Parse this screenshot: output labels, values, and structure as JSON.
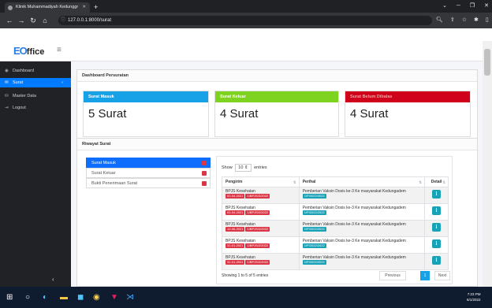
{
  "browser": {
    "tab_title": "Klinik Muhammadiyah Kedunggr",
    "url": "127.0.0.1:8000/surat"
  },
  "app": {
    "logo_text": "ffice",
    "sidebar": {
      "items": [
        {
          "label": "Dashboard",
          "icon": "palette-icon"
        },
        {
          "label": "Surat",
          "icon": "envelope-icon"
        },
        {
          "label": "Master Data",
          "icon": "database-icon"
        },
        {
          "label": "Logout",
          "icon": "logout-icon"
        }
      ]
    },
    "page_title": "Dashboard Persuratan",
    "cards": [
      {
        "label": "Surat Masuk",
        "value": "5 Surat",
        "color": "#17a2e8"
      },
      {
        "label": "Surat Keluar",
        "value": "4 Surat",
        "color": "#7ed321"
      },
      {
        "label": "Surat Belum Dibalas",
        "value": "4 Surat",
        "color": "#d0021b"
      }
    ],
    "riwayat": {
      "title": "Riwayat Surat",
      "list": [
        {
          "label": "Surat Masuk",
          "active": true
        },
        {
          "label": "Surat Keluar",
          "active": false
        },
        {
          "label": "Bukti Penerimaan Surat",
          "active": false
        }
      ],
      "show_label": "Show",
      "show_value": "10",
      "entries_label": "entries",
      "columns": [
        "Pengirim",
        "Perihal",
        "Detail"
      ],
      "rows": [
        {
          "pengirim": "BPJS Kesehatan",
          "tag1": "02-04-2021",
          "tag2": "1/BPJS/2/2022",
          "perihal": "Pemberian Vaksin Dosis ke-3 Ke masyarakat Kedungadem",
          "tag3": "1/P/2022/2022"
        },
        {
          "pengirim": "BPJS Kesehatan",
          "tag1": "02-04-2021",
          "tag2": "1/BPJS/2/2022",
          "perihal": "Pemberian Vaksin Dosis ke-3 Ke masyarakat Kedungadem",
          "tag3": "1/P/2022/2022"
        },
        {
          "pengirim": "BPJS Kesehatan",
          "tag1": "12-06-2021",
          "tag2": "1/BPJS/2/2022",
          "perihal": "Pemberian Vaksin Dosis ke-3 Ke masyarakat Kedungadem",
          "tag3": "1/P/2022/2022"
        },
        {
          "pengirim": "BPJS Kesehatan",
          "tag1": "31-01-2021",
          "tag2": "1/BPJS/2/2022",
          "perihal": "Pemberian Vaksin Dosis ke-3 Ke masyarakat Kedungadem",
          "tag3": "1/P/2022/2022"
        },
        {
          "pengirim": "BPJS Kesehatan",
          "tag1": "31-01-2021",
          "tag2": "1/BPJS/2/2022",
          "perihal": "Pemberian Vaksin Dosis ke-3 Ke masyarakat Kedungadem",
          "tag3": "1/P/2022/2022"
        }
      ],
      "detail_label": "i",
      "info": "Showing 1 to 5 of 5 entries",
      "pagination": {
        "previous": "Previous",
        "page": "1",
        "next": "Next"
      }
    }
  },
  "taskbar": {
    "time": "7:23 PM",
    "date": "6/1/2022"
  }
}
